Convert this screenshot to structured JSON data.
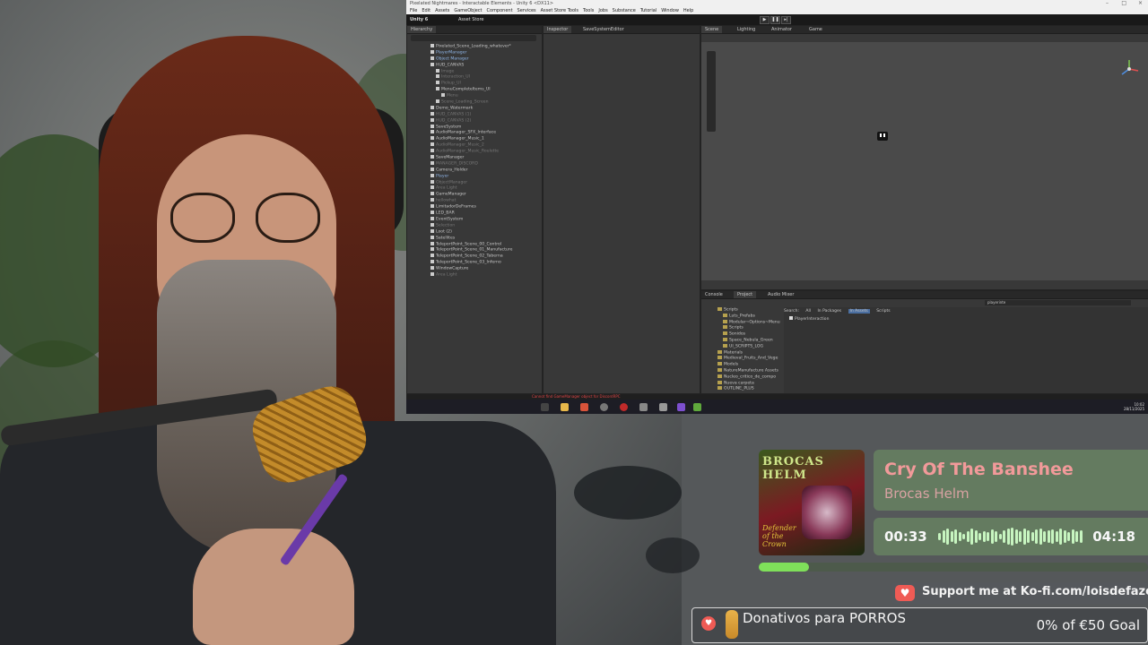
{
  "unity": {
    "window_title": "Pixelated Nightmares - Interactable Elements - Unity 6 <DX11>",
    "menu": [
      "File",
      "Edit",
      "Assets",
      "GameObject",
      "Component",
      "Services",
      "Asset Store Tools",
      "Tools",
      "Jobs",
      "Substance",
      "Tutorial",
      "Window",
      "Help"
    ],
    "account_label": "Unity 6",
    "asset_store_label": "Asset Store",
    "hierarchy_tab": "Hierarchy",
    "inspector_tab": "Inspector",
    "editor_tab": "SaveSystemEditor",
    "scene_tab": "Scene",
    "lighting_tab": "Lighting",
    "animator_tab": "Animator",
    "game_tab": "Game",
    "console_tab": "Console",
    "project_tab": "Project",
    "audio_mixer_tab": "Audio Mixer",
    "hierarchy_items": [
      "Pixelated_Scene_Loading_whatever*",
      "PlayerManager",
      "Object Manager",
      "HUD_CANVAS",
      "Image",
      "Interaction_UI",
      "Pickup_UI",
      "MenuCompleteItems_UI",
      "Menu",
      "Scene_Loading_Screen",
      "Demo_Watermark",
      "HUD_CANVAS (1)",
      "HUD_CANVAS (2)",
      "SaveSystem",
      "AudioManager_SFX_Interface",
      "AudioManager_Music_1",
      "AudioManager_Music_2",
      "AudioManager_Music_Roulette",
      "SaveManager",
      "MANAGER_DISCORD",
      "Camera_Holder",
      "Player",
      "ObjectManager",
      "Area Light",
      "GameManager",
      "hellowhat",
      "LimitadorDeFrames",
      "LED_BAR",
      "EventSystem",
      "Selection",
      "Loot (2)",
      "Satellites",
      "TeleportPoint_Scene_00_Control",
      "TeleportPoint_Scene_01_Manufacture",
      "TeleportPoint_Scene_02_Taberna",
      "TeleportPoint_Scene_03_Inferno",
      "WindowCapture",
      "Area Light"
    ],
    "project_folders": [
      "Scripts",
      "Luts_Prefabs",
      "Modular~Options~Menu",
      "Scripts",
      "Sonidos",
      "Space_Nebula_Green",
      "UI_SCRIPTS_LOG",
      "Materials",
      "Medieval_Fruits_And_Vege",
      "Models",
      "NatureManufacture Assets",
      "Nucleo_critico_de_compo",
      "Nueva carpeta",
      "OUTLINE_PLUS"
    ],
    "project_search_label": "Search:",
    "project_search_scopes": [
      "All",
      "In Packages",
      "In Assets",
      "Scripts"
    ],
    "project_search_value": "playerinte",
    "project_result": "PlayerInteraction",
    "status_error": "Cannot find GameManager object for DiscordRPC",
    "tray_time": "10:02",
    "tray_date": "28/11/2025"
  },
  "now_playing": {
    "track_title": "Cry Of The Banshee",
    "artist": "Brocas Helm",
    "album_art_title": "BROCAS HELM",
    "album_art_subtitle": "Defender of the Crown",
    "current_time": "00:33",
    "total_time": "04:18",
    "progress_fraction": 0.128,
    "visualizer_levels": [
      0.4,
      0.7,
      0.9,
      0.6,
      0.8,
      0.5,
      0.3,
      0.6,
      0.9,
      0.7,
      0.4,
      0.6,
      0.5,
      0.8,
      0.6,
      0.3,
      0.7,
      0.9,
      1.0,
      0.8,
      0.6,
      0.9,
      0.7,
      0.5,
      0.8,
      0.9,
      0.6,
      0.7,
      0.8,
      0.6,
      0.9,
      0.7,
      0.5,
      0.8,
      0.6,
      0.7
    ]
  },
  "kofi": {
    "text": "Support me at Ko-fi.com/loisdefazouro"
  },
  "donation": {
    "title": "Donativos para PORROS",
    "goal": "0% of €50 Goal"
  },
  "colors": {
    "track_title": "#f29a9a",
    "panel_bg": "#647b60",
    "progress": "#7fe05a",
    "kofi": "#ef5b55"
  }
}
